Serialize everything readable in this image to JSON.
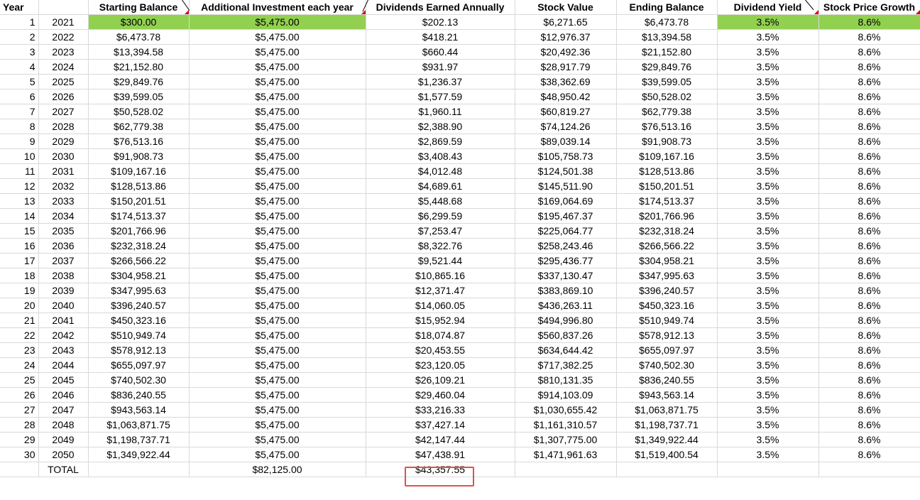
{
  "headers": {
    "year": "Year",
    "year_col": "",
    "starting_balance": "Starting Balance",
    "additional_investment": "Additional Investment each year",
    "dividends_earned": "Dividends Earned Annually",
    "stock_value": "Stock Value",
    "ending_balance": "Ending Balance",
    "dividend_yield": "Dividend Yield",
    "stock_price_growth": "Stock Price Growth"
  },
  "rows": [
    {
      "i": "1",
      "y": "2021",
      "sb": "$300.00",
      "ai": "$5,475.00",
      "de": "$202.13",
      "sv": "$6,271.65",
      "eb": "$6,473.78",
      "dy": "3.5%",
      "sg": "8.6%"
    },
    {
      "i": "2",
      "y": "2022",
      "sb": "$6,473.78",
      "ai": "$5,475.00",
      "de": "$418.21",
      "sv": "$12,976.37",
      "eb": "$13,394.58",
      "dy": "3.5%",
      "sg": "8.6%"
    },
    {
      "i": "3",
      "y": "2023",
      "sb": "$13,394.58",
      "ai": "$5,475.00",
      "de": "$660.44",
      "sv": "$20,492.36",
      "eb": "$21,152.80",
      "dy": "3.5%",
      "sg": "8.6%"
    },
    {
      "i": "4",
      "y": "2024",
      "sb": "$21,152.80",
      "ai": "$5,475.00",
      "de": "$931.97",
      "sv": "$28,917.79",
      "eb": "$29,849.76",
      "dy": "3.5%",
      "sg": "8.6%"
    },
    {
      "i": "5",
      "y": "2025",
      "sb": "$29,849.76",
      "ai": "$5,475.00",
      "de": "$1,236.37",
      "sv": "$38,362.69",
      "eb": "$39,599.05",
      "dy": "3.5%",
      "sg": "8.6%"
    },
    {
      "i": "6",
      "y": "2026",
      "sb": "$39,599.05",
      "ai": "$5,475.00",
      "de": "$1,577.59",
      "sv": "$48,950.42",
      "eb": "$50,528.02",
      "dy": "3.5%",
      "sg": "8.6%"
    },
    {
      "i": "7",
      "y": "2027",
      "sb": "$50,528.02",
      "ai": "$5,475.00",
      "de": "$1,960.11",
      "sv": "$60,819.27",
      "eb": "$62,779.38",
      "dy": "3.5%",
      "sg": "8.6%"
    },
    {
      "i": "8",
      "y": "2028",
      "sb": "$62,779.38",
      "ai": "$5,475.00",
      "de": "$2,388.90",
      "sv": "$74,124.26",
      "eb": "$76,513.16",
      "dy": "3.5%",
      "sg": "8.6%"
    },
    {
      "i": "9",
      "y": "2029",
      "sb": "$76,513.16",
      "ai": "$5,475.00",
      "de": "$2,869.59",
      "sv": "$89,039.14",
      "eb": "$91,908.73",
      "dy": "3.5%",
      "sg": "8.6%"
    },
    {
      "i": "10",
      "y": "2030",
      "sb": "$91,908.73",
      "ai": "$5,475.00",
      "de": "$3,408.43",
      "sv": "$105,758.73",
      "eb": "$109,167.16",
      "dy": "3.5%",
      "sg": "8.6%"
    },
    {
      "i": "11",
      "y": "2031",
      "sb": "$109,167.16",
      "ai": "$5,475.00",
      "de": "$4,012.48",
      "sv": "$124,501.38",
      "eb": "$128,513.86",
      "dy": "3.5%",
      "sg": "8.6%"
    },
    {
      "i": "12",
      "y": "2032",
      "sb": "$128,513.86",
      "ai": "$5,475.00",
      "de": "$4,689.61",
      "sv": "$145,511.90",
      "eb": "$150,201.51",
      "dy": "3.5%",
      "sg": "8.6%"
    },
    {
      "i": "13",
      "y": "2033",
      "sb": "$150,201.51",
      "ai": "$5,475.00",
      "de": "$5,448.68",
      "sv": "$169,064.69",
      "eb": "$174,513.37",
      "dy": "3.5%",
      "sg": "8.6%"
    },
    {
      "i": "14",
      "y": "2034",
      "sb": "$174,513.37",
      "ai": "$5,475.00",
      "de": "$6,299.59",
      "sv": "$195,467.37",
      "eb": "$201,766.96",
      "dy": "3.5%",
      "sg": "8.6%"
    },
    {
      "i": "15",
      "y": "2035",
      "sb": "$201,766.96",
      "ai": "$5,475.00",
      "de": "$7,253.47",
      "sv": "$225,064.77",
      "eb": "$232,318.24",
      "dy": "3.5%",
      "sg": "8.6%"
    },
    {
      "i": "16",
      "y": "2036",
      "sb": "$232,318.24",
      "ai": "$5,475.00",
      "de": "$8,322.76",
      "sv": "$258,243.46",
      "eb": "$266,566.22",
      "dy": "3.5%",
      "sg": "8.6%"
    },
    {
      "i": "17",
      "y": "2037",
      "sb": "$266,566.22",
      "ai": "$5,475.00",
      "de": "$9,521.44",
      "sv": "$295,436.77",
      "eb": "$304,958.21",
      "dy": "3.5%",
      "sg": "8.6%"
    },
    {
      "i": "18",
      "y": "2038",
      "sb": "$304,958.21",
      "ai": "$5,475.00",
      "de": "$10,865.16",
      "sv": "$337,130.47",
      "eb": "$347,995.63",
      "dy": "3.5%",
      "sg": "8.6%"
    },
    {
      "i": "19",
      "y": "2039",
      "sb": "$347,995.63",
      "ai": "$5,475.00",
      "de": "$12,371.47",
      "sv": "$383,869.10",
      "eb": "$396,240.57",
      "dy": "3.5%",
      "sg": "8.6%"
    },
    {
      "i": "20",
      "y": "2040",
      "sb": "$396,240.57",
      "ai": "$5,475.00",
      "de": "$14,060.05",
      "sv": "$436,263.11",
      "eb": "$450,323.16",
      "dy": "3.5%",
      "sg": "8.6%"
    },
    {
      "i": "21",
      "y": "2041",
      "sb": "$450,323.16",
      "ai": "$5,475.00",
      "de": "$15,952.94",
      "sv": "$494,996.80",
      "eb": "$510,949.74",
      "dy": "3.5%",
      "sg": "8.6%"
    },
    {
      "i": "22",
      "y": "2042",
      "sb": "$510,949.74",
      "ai": "$5,475.00",
      "de": "$18,074.87",
      "sv": "$560,837.26",
      "eb": "$578,912.13",
      "dy": "3.5%",
      "sg": "8.6%"
    },
    {
      "i": "23",
      "y": "2043",
      "sb": "$578,912.13",
      "ai": "$5,475.00",
      "de": "$20,453.55",
      "sv": "$634,644.42",
      "eb": "$655,097.97",
      "dy": "3.5%",
      "sg": "8.6%"
    },
    {
      "i": "24",
      "y": "2044",
      "sb": "$655,097.97",
      "ai": "$5,475.00",
      "de": "$23,120.05",
      "sv": "$717,382.25",
      "eb": "$740,502.30",
      "dy": "3.5%",
      "sg": "8.6%"
    },
    {
      "i": "25",
      "y": "2045",
      "sb": "$740,502.30",
      "ai": "$5,475.00",
      "de": "$26,109.21",
      "sv": "$810,131.35",
      "eb": "$836,240.55",
      "dy": "3.5%",
      "sg": "8.6%"
    },
    {
      "i": "26",
      "y": "2046",
      "sb": "$836,240.55",
      "ai": "$5,475.00",
      "de": "$29,460.04",
      "sv": "$914,103.09",
      "eb": "$943,563.14",
      "dy": "3.5%",
      "sg": "8.6%"
    },
    {
      "i": "27",
      "y": "2047",
      "sb": "$943,563.14",
      "ai": "$5,475.00",
      "de": "$33,216.33",
      "sv": "$1,030,655.42",
      "eb": "$1,063,871.75",
      "dy": "3.5%",
      "sg": "8.6%"
    },
    {
      "i": "28",
      "y": "2048",
      "sb": "$1,063,871.75",
      "ai": "$5,475.00",
      "de": "$37,427.14",
      "sv": "$1,161,310.57",
      "eb": "$1,198,737.71",
      "dy": "3.5%",
      "sg": "8.6%"
    },
    {
      "i": "29",
      "y": "2049",
      "sb": "$1,198,737.71",
      "ai": "$5,475.00",
      "de": "$42,147.44",
      "sv": "$1,307,775.00",
      "eb": "$1,349,922.44",
      "dy": "3.5%",
      "sg": "8.6%"
    },
    {
      "i": "30",
      "y": "2050",
      "sb": "$1,349,922.44",
      "ai": "$5,475.00",
      "de": "$47,438.91",
      "sv": "$1,471,961.63",
      "eb": "$1,519,400.54",
      "dy": "3.5%",
      "sg": "8.6%"
    }
  ],
  "total": {
    "label": "TOTAL",
    "additional_investment": "$82,125.00",
    "dividends": "$43,357.55"
  },
  "colors": {
    "input_fill": "#92d050",
    "comment_marker": "#e00000",
    "highlight_border": "#e05050",
    "gridline": "#d9d9d9"
  }
}
